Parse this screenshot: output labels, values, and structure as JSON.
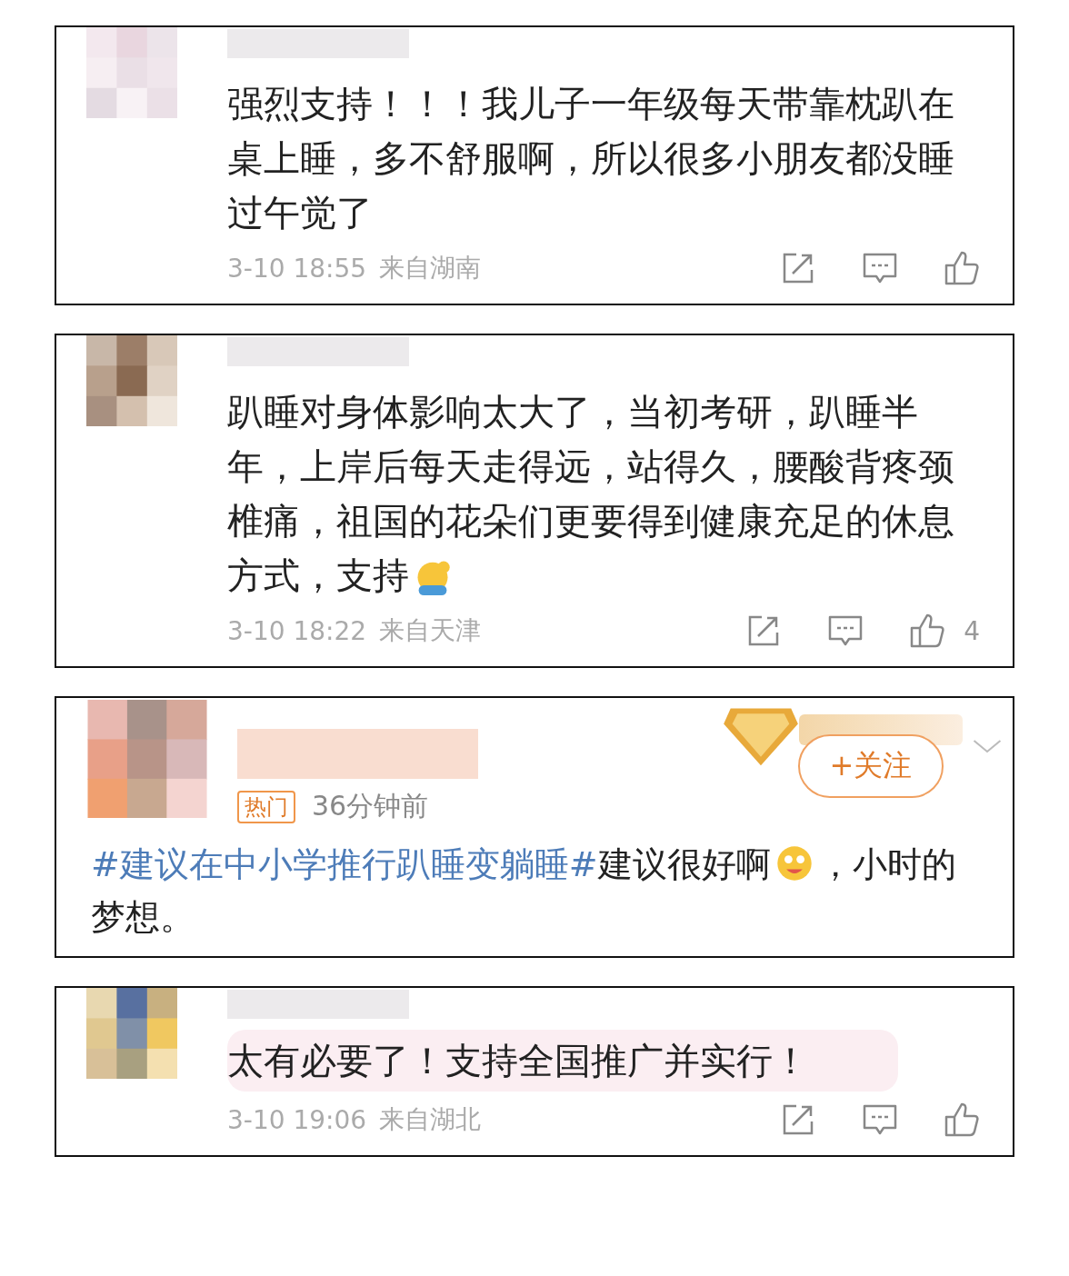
{
  "comments": [
    {
      "kind": "standard",
      "text": "强烈支持！！！我儿子一年级每天带靠枕趴在桌上睡，多不舒服啊，所以很多小朋友都没睡过午觉了",
      "emoji": false,
      "bubble": false,
      "time": "3-10 18:55",
      "location": "来自湖南"
    },
    {
      "kind": "standard",
      "text": "趴睡对身体影响太大了，当初考研，趴睡半年，上岸后每天走得远，站得久，腰酸背疼颈椎痛，祖国的花朵们更要得到健康充足的休息方式，支持",
      "emoji": true,
      "bubble": false,
      "time": "3-10 18:22",
      "location": "来自天津",
      "like_count": "4"
    },
    {
      "kind": "featured",
      "hashtag": "#建议在中小学推行趴睡变躺睡#",
      "text": "建议很好啊",
      "emoji": true,
      "text_after": "，小时的梦想。",
      "tag": "热门",
      "time": "36分钟前",
      "follow_button": "+关注"
    },
    {
      "kind": "standard",
      "text": "太有必要了！支持全国推广并实行！",
      "emoji": false,
      "bubble": true,
      "time": "3-10 19:06",
      "location": "来自湖北"
    }
  ]
}
